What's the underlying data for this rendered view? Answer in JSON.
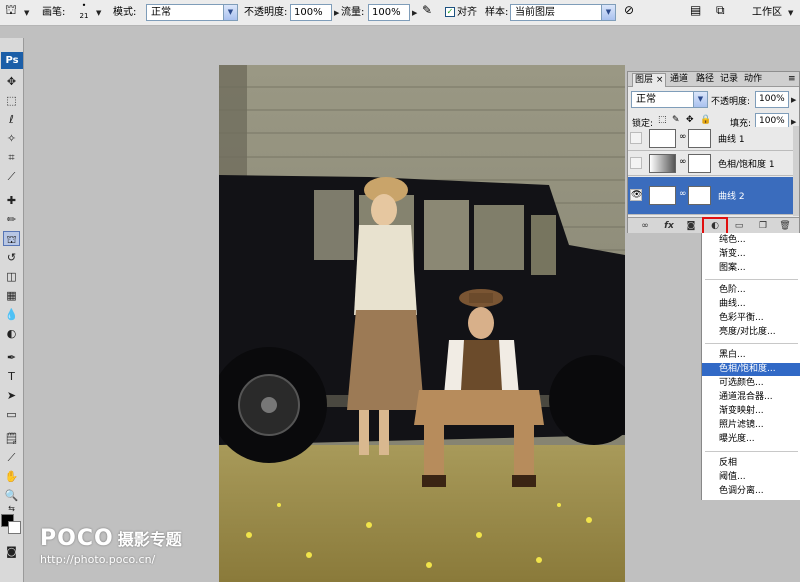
{
  "options_bar": {
    "brush_label": "画笔:",
    "brush_size": "21",
    "mode_label": "模式:",
    "mode_value": "正常",
    "opacity_label": "不透明度:",
    "opacity_value": "100%",
    "flow_label": "流量:",
    "flow_value": "100%",
    "align_label": "对齐",
    "sample_label": "样本:",
    "sample_value": "当前图层",
    "workspace_label": "工作区"
  },
  "toolbox": {
    "logo": "Ps"
  },
  "watermark": {
    "brand": "POCO",
    "zh": "摄影专题",
    "url": "http://photo.poco.cn/"
  },
  "layers_panel": {
    "tabs": [
      "图层",
      "通道",
      "路径",
      "记录",
      "动作"
    ],
    "blend_mode": "正常",
    "opacity_label": "不透明度:",
    "opacity_value": "100%",
    "lock_label": "锁定:",
    "fill_label": "填充:",
    "fill_value": "100%",
    "layers": [
      {
        "name": "曲线 1",
        "visible": false,
        "selected": false
      },
      {
        "name": "色相/饱和度 1",
        "visible": false,
        "selected": false
      },
      {
        "name": "曲线 2",
        "visible": true,
        "selected": true
      }
    ]
  },
  "adjustment_menu": {
    "groups": [
      [
        "纯色...",
        "渐变...",
        "图案..."
      ],
      [
        "色阶...",
        "曲线...",
        "色彩平衡...",
        "亮度/对比度..."
      ],
      [
        "黑白...",
        "色相/饱和度...",
        "可选颜色...",
        "通道混合器...",
        "渐变映射...",
        "照片滤镜...",
        "曝光度..."
      ],
      [
        "反相",
        "阈值...",
        "色调分离..."
      ]
    ],
    "highlighted": "色相/饱和度..."
  },
  "colors": {
    "selection_blue": "#3a6cbd",
    "menu_highlight": "#3169c6",
    "highlight_box": "#e01010"
  }
}
